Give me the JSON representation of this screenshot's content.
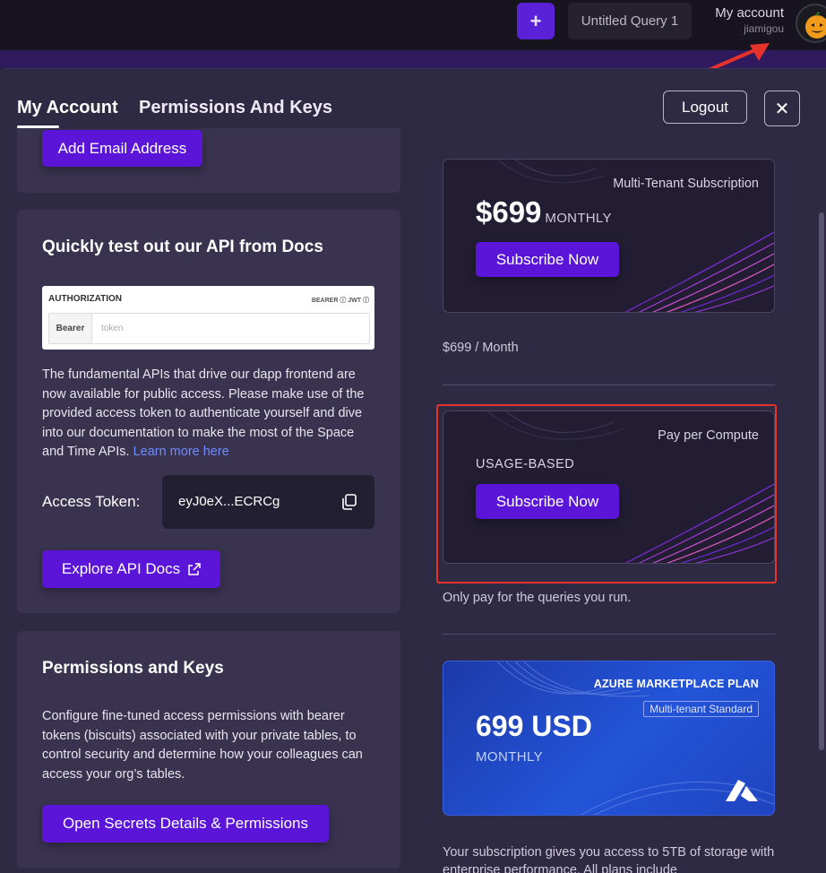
{
  "topbar": {
    "plus_label": "+",
    "query_tab": "Untitled Query 1",
    "account_title": "My account",
    "account_user": "jiamigou"
  },
  "modal": {
    "tabs": [
      {
        "label": "My Account",
        "active": true
      },
      {
        "label": "Permissions And Keys",
        "active": false
      }
    ],
    "logout_label": "Logout",
    "close_glyph": "✕"
  },
  "email_card": {
    "button_label": "Add Email Address"
  },
  "api_card": {
    "title": "Quickly test out our API from Docs",
    "auth_image": {
      "heading": "AUTHORIZATION",
      "options": "BEARER ⓘ   JWT ⓘ",
      "field_label": "Bearer",
      "placeholder": "token"
    },
    "description": "The fundamental APIs that drive our dapp frontend are now available for public access. Please make use of the provided access token to authenticate yourself and dive into our documentation to make the most of the Space and Time APIs.",
    "link_text": "Learn more here",
    "token_label": "Access Token:",
    "token_value": "eyJ0eX...ECRCg",
    "explore_label": "Explore API Docs"
  },
  "perms_card": {
    "title": "Permissions and Keys",
    "description": "Configure fine-tuned access permissions with bearer tokens (biscuits) associated with your private tables, to control security and determine how your colleagues can access your org’s tables.",
    "button_label": "Open Secrets Details & Permissions"
  },
  "plans": {
    "multi_tenant": {
      "tag": "Multi-Tenant Subscription",
      "price": "$699",
      "period": "MONTHLY",
      "button_label": "Subscribe Now",
      "caption": "$699 / Month"
    },
    "usage": {
      "tag": "Pay per Compute",
      "label": "USAGE-BASED",
      "button_label": "Subscribe Now",
      "caption": "Only pay for the queries you run."
    },
    "azure": {
      "tag": "AZURE MARKETPLACE PLAN",
      "sub_tag": "Multi-tenant Standard",
      "price": "699 USD",
      "period": "MONTHLY"
    },
    "bottom_text": "Your subscription gives you access to 5TB of storage with enterprise performance. All plans include"
  },
  "colors": {
    "accent": "#5a15d9",
    "highlight": "#e5322b",
    "link": "#6f8cff"
  }
}
